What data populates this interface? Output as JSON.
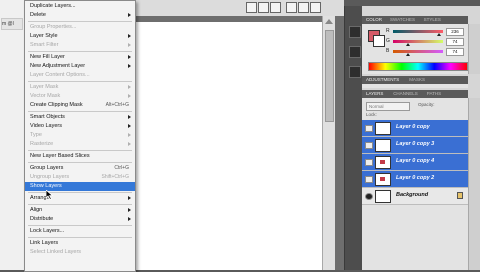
{
  "left_tab": {
    "label": "m @l"
  },
  "menu": {
    "items": [
      {
        "label": "Duplicate Layers...",
        "disabled": false,
        "submenu": false,
        "shortcut": ""
      },
      {
        "label": "Delete",
        "disabled": false,
        "submenu": true,
        "shortcut": ""
      },
      {
        "sep": true
      },
      {
        "label": "Group Properties...",
        "disabled": true,
        "submenu": false,
        "shortcut": ""
      },
      {
        "label": "Layer Style",
        "disabled": false,
        "submenu": true,
        "shortcut": ""
      },
      {
        "label": "Smart Filter",
        "disabled": true,
        "submenu": true,
        "shortcut": ""
      },
      {
        "sep": true
      },
      {
        "label": "New Fill Layer",
        "disabled": false,
        "submenu": true,
        "shortcut": ""
      },
      {
        "label": "New Adjustment Layer",
        "disabled": false,
        "submenu": true,
        "shortcut": ""
      },
      {
        "label": "Layer Content Options...",
        "disabled": true,
        "submenu": false,
        "shortcut": ""
      },
      {
        "sep": true
      },
      {
        "label": "Layer Mask",
        "disabled": true,
        "submenu": true,
        "shortcut": ""
      },
      {
        "label": "Vector Mask",
        "disabled": true,
        "submenu": true,
        "shortcut": ""
      },
      {
        "label": "Create Clipping Mask",
        "disabled": false,
        "submenu": false,
        "shortcut": "Alt+Ctrl+G"
      },
      {
        "sep": true
      },
      {
        "label": "Smart Objects",
        "disabled": false,
        "submenu": true,
        "shortcut": ""
      },
      {
        "label": "Video Layers",
        "disabled": false,
        "submenu": true,
        "shortcut": ""
      },
      {
        "label": "Type",
        "disabled": true,
        "submenu": true,
        "shortcut": ""
      },
      {
        "label": "Rasterize",
        "disabled": true,
        "submenu": true,
        "shortcut": ""
      },
      {
        "sep": true
      },
      {
        "label": "New Layer Based Slices",
        "disabled": false,
        "submenu": false,
        "shortcut": ""
      },
      {
        "sep": true
      },
      {
        "label": "Group Layers",
        "disabled": false,
        "submenu": false,
        "shortcut": "Ctrl+G"
      },
      {
        "label": "Ungroup Layers",
        "disabled": true,
        "submenu": false,
        "shortcut": "Shift+Ctrl+G"
      },
      {
        "label": "Show Layers",
        "disabled": false,
        "submenu": false,
        "shortcut": "",
        "highlight": true
      },
      {
        "sep": true
      },
      {
        "label": "Arrange",
        "disabled": false,
        "submenu": true,
        "shortcut": ""
      },
      {
        "sep": true
      },
      {
        "label": "Align",
        "disabled": false,
        "submenu": true,
        "shortcut": ""
      },
      {
        "label": "Distribute",
        "disabled": false,
        "submenu": true,
        "shortcut": ""
      },
      {
        "sep": true
      },
      {
        "label": "Lock Layers...",
        "disabled": false,
        "submenu": false,
        "shortcut": ""
      },
      {
        "sep": true
      },
      {
        "label": "Link Layers",
        "disabled": false,
        "submenu": false,
        "shortcut": ""
      },
      {
        "label": "Select Linked Layers",
        "disabled": true,
        "submenu": false,
        "shortcut": ""
      }
    ]
  },
  "color_panel": {
    "tabs": [
      {
        "label": "COLOR",
        "active": true
      },
      {
        "label": "SWATCHES",
        "active": false
      },
      {
        "label": "STYLES",
        "active": false
      }
    ],
    "foreground": "#d45a67",
    "background": "#ffffff",
    "sliders": [
      {
        "channel": "R",
        "value": "236",
        "level": 0.92,
        "gradient": "linear-gradient(to right,#005a67,#ff5a67)"
      },
      {
        "channel": "G",
        "value": "74",
        "level": 0.29,
        "gradient": "linear-gradient(to right,#d40067,#d4ff67)"
      },
      {
        "channel": "B",
        "value": "74",
        "level": 0.29,
        "gradient": "linear-gradient(to right,#d45a00,#d45aff)"
      }
    ]
  },
  "adjust_panel": {
    "tabs": [
      {
        "label": "ADJUSTMENTS",
        "active": true
      },
      {
        "label": "MASKS",
        "active": false
      }
    ]
  },
  "layers_panel": {
    "tabs": [
      {
        "label": "LAYERS",
        "active": true
      },
      {
        "label": "CHANNELS",
        "active": false
      },
      {
        "label": "PATHS",
        "active": false
      }
    ],
    "blend_mode": "Normal",
    "opacity_label": "Opacity:",
    "lock_label": "Lock:",
    "layers": [
      {
        "name": "Layer 0 copy",
        "selected": true,
        "visible": false,
        "has_dot": false,
        "locked": false
      },
      {
        "name": "Layer 0 copy 3",
        "selected": true,
        "visible": false,
        "has_dot": false,
        "locked": false
      },
      {
        "name": "Layer 0 copy 4",
        "selected": true,
        "visible": false,
        "has_dot": true,
        "locked": false
      },
      {
        "name": "Layer 0 copy 2",
        "selected": true,
        "visible": false,
        "has_dot": true,
        "locked": false
      },
      {
        "name": "Background",
        "selected": false,
        "visible": true,
        "has_dot": false,
        "locked": true
      }
    ]
  }
}
